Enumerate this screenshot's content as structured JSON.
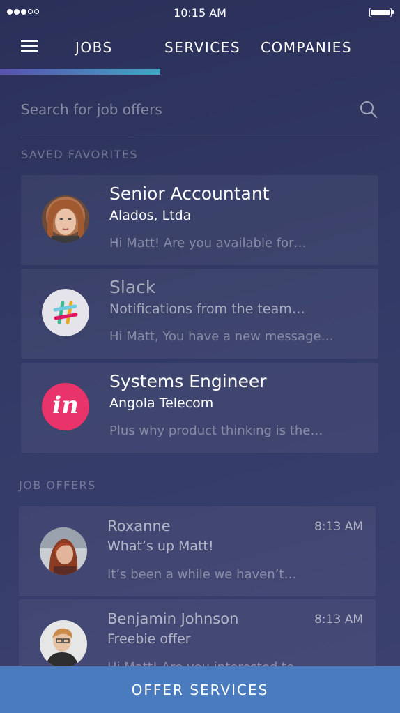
{
  "status_bar": {
    "time": "10:15 AM",
    "signal_bars": 3,
    "signal_total": 5
  },
  "nav": {
    "tabs": [
      {
        "label": "JOBS",
        "active": true
      },
      {
        "label": "SERVICES",
        "active": false
      },
      {
        "label": "COMPANIES",
        "active": false
      }
    ]
  },
  "search": {
    "placeholder": "Search for job offers",
    "value": ""
  },
  "saved_favorites": {
    "label": "SAVED FAVORITES",
    "items": [
      {
        "title": "Senior Accountant",
        "subtitle": "Alados, Ltda",
        "preview": "Hi Matt! Are you available for…",
        "avatar": "woman-portrait"
      },
      {
        "title": "Slack",
        "subtitle": "Notifications from the team…",
        "preview": "Hi Matt, You have a new message…",
        "avatar": "slack-logo-icon"
      },
      {
        "title": "Systems Engineer",
        "subtitle": "Angola Telecom",
        "preview": "Plus why product thinking is the…",
        "avatar": "invision-logo-icon",
        "logo_text": "in"
      }
    ]
  },
  "job_offers": {
    "label": "JOB OFFERS",
    "items": [
      {
        "name": "Roxanne",
        "time": "8:13 AM",
        "message": "What’s up Matt!",
        "preview": "It’s been a while we haven’t…",
        "avatar": "woman-red-hair-portrait"
      },
      {
        "name": "Benjamin Johnson",
        "time": "8:13 AM",
        "message": "Freebie offer",
        "preview": "Hi Matt! Are you interested to…",
        "avatar": "man-glasses-portrait"
      }
    ]
  },
  "bottom_button": {
    "label": "OFFER SERVICES"
  },
  "colors": {
    "background": "#2f3560",
    "tab_indicator_start": "#5a4fb0",
    "tab_indicator_end": "#3ea8c4",
    "bottom_button": "#4a7bbf",
    "invision_brand": "#e8336b"
  }
}
